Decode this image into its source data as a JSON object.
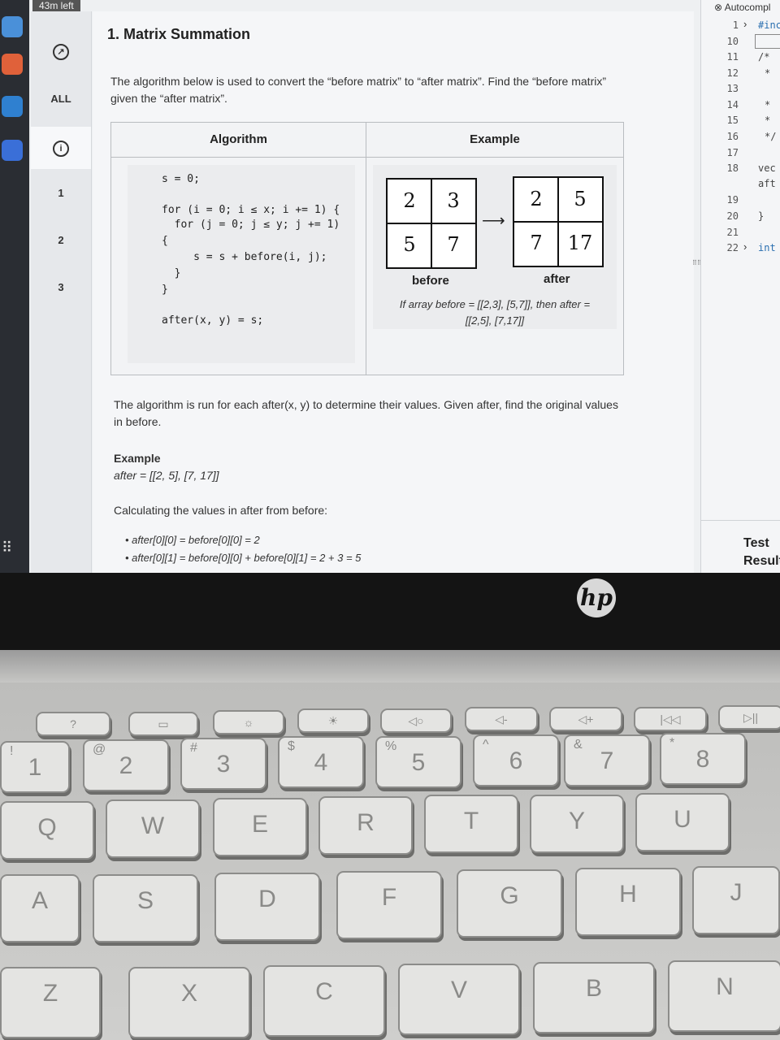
{
  "timer": "43m left",
  "question_nav": {
    "all_label": "ALL",
    "items": [
      "1",
      "2",
      "3"
    ]
  },
  "question": {
    "title": "1. Matrix Summation",
    "intro_line1": "The algorithm below is used to convert the “before matrix” to “after matrix”. Find the “before matrix”",
    "intro_line2": "given the “after matrix”.",
    "table_header_algorithm": "Algorithm",
    "table_header_example": "Example",
    "code_lines": [
      "s = 0;",
      "for (i = 0; i ≤ x; i += 1) {",
      "  for (j = 0; j ≤ y; j += 1)",
      "{",
      "     s = s + before(i, j);",
      "  }",
      "}",
      "after(x, y) = s;"
    ],
    "before_matrix": [
      [
        "2",
        "3"
      ],
      [
        "5",
        "7"
      ]
    ],
    "after_matrix": [
      [
        "2",
        "5"
      ],
      [
        "7",
        "17"
      ]
    ],
    "before_label": "before",
    "after_label": "after",
    "example_caption_line1": "If array before = [[2,3], [5,7]], then after =",
    "example_caption_line2": "[[2,5], [7,17]]",
    "desc_line1": "The algorithm is run for each after(x, y) to determine their values. Given after, find the original values",
    "desc_line2": "in before.",
    "example_heading": "Example",
    "example_after": "after = [[2, 5], [7, 17]]",
    "calc_intro": "Calculating the values in after from before:",
    "bullets": [
      "after[0][0] = before[0][0] = 2",
      "after[0][1] = before[0][0] + before[0][1] = 2 + 3 = 5"
    ]
  },
  "editor": {
    "autocomplete_label": "Autocompl",
    "line_numbers": [
      "1",
      "10",
      "11",
      "12",
      "13",
      "14",
      "15",
      "16",
      "17",
      "18",
      "19",
      "20",
      "21",
      "22"
    ],
    "code_fragments": [
      "#inc",
      "/*",
      "*",
      "*",
      "*",
      "*/",
      "vec",
      "aft",
      "}",
      "int"
    ],
    "test_results_label": "Test Results"
  },
  "laptop": {
    "brand_logo": "hp",
    "keys_row_fn": [
      "?",
      "▭",
      "☼",
      "☀",
      "◁○",
      "◁-",
      "◁+",
      "|◁◁",
      "▷||"
    ],
    "keys_row_num": [
      {
        "main": "1",
        "shift": "!"
      },
      {
        "main": "2",
        "shift": "@"
      },
      {
        "main": "3",
        "shift": "#"
      },
      {
        "main": "4",
        "shift": "$"
      },
      {
        "main": "5",
        "shift": "%"
      },
      {
        "main": "6",
        "shift": "^"
      },
      {
        "main": "7",
        "shift": "&"
      },
      {
        "main": "8",
        "shift": "*"
      }
    ],
    "keys_row_q": [
      "Q",
      "W",
      "E",
      "R",
      "T",
      "Y",
      "U"
    ],
    "keys_row_a": [
      "A",
      "S",
      "D",
      "F",
      "G",
      "H",
      "J"
    ],
    "keys_row_z": [
      "Z",
      "X",
      "C",
      "V",
      "B",
      "N"
    ]
  },
  "colors": {
    "screen_bg": "#eef0f2",
    "bezel": "#141414",
    "key_face": "#e4e4e2"
  }
}
